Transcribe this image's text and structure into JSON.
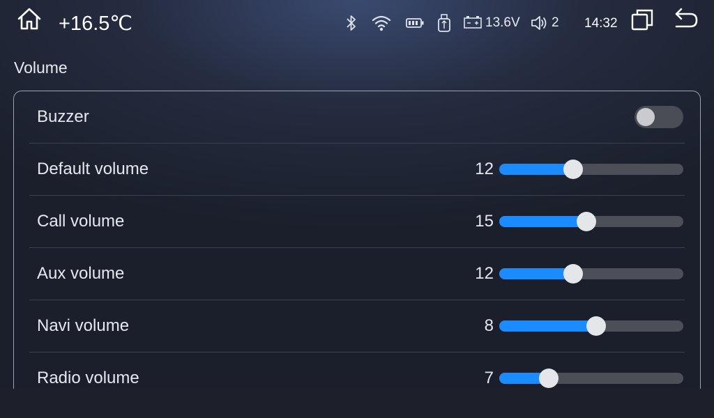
{
  "status_bar": {
    "temperature": "+16.5℃",
    "voltage": "13.6V",
    "speaker_level": "2",
    "time": "14:32",
    "icons": [
      "home-icon",
      "bluetooth-icon",
      "wifi-icon",
      "battery-icon",
      "usb-icon",
      "car-battery-icon",
      "speaker-icon",
      "recent-apps-icon",
      "back-icon"
    ]
  },
  "page": {
    "section_title": "Volume"
  },
  "settings": {
    "buzzer": {
      "label": "Buzzer",
      "enabled": false
    },
    "sliders": [
      {
        "label": "Default volume",
        "value": "12",
        "level": 0.39
      },
      {
        "label": "Call volume",
        "value": "15",
        "level": 0.47
      },
      {
        "label": "Aux volume",
        "value": "12",
        "level": 0.39
      },
      {
        "label": "Navi volume",
        "value": "8",
        "level": 0.53
      },
      {
        "label": "Radio volume",
        "value": "7",
        "level": 0.24
      }
    ]
  },
  "colors": {
    "accent": "#1a8cff",
    "track": "#4c4f57",
    "thumb": "#e5e6ea",
    "toggle_off": "#4a4d55"
  }
}
